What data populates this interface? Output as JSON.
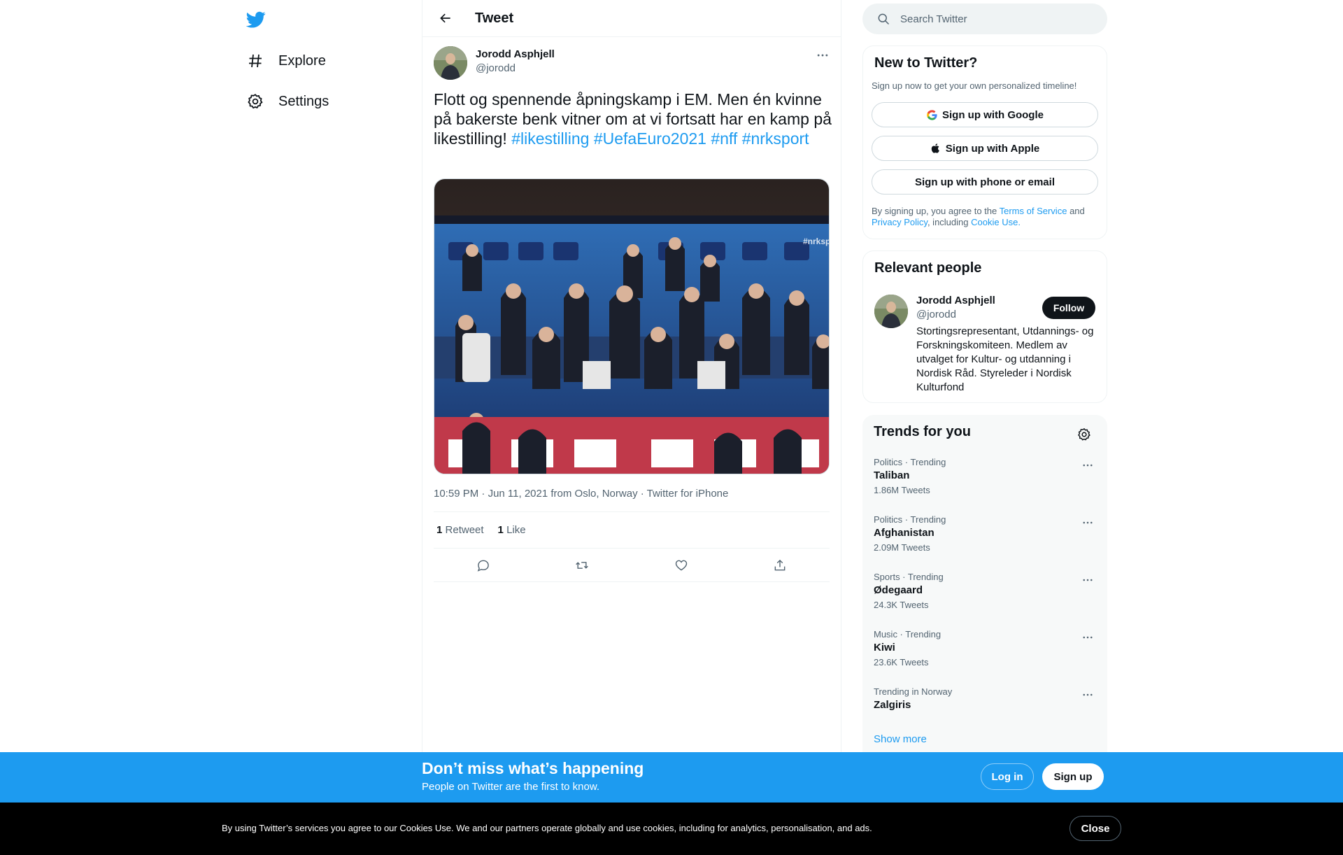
{
  "colors": {
    "accent": "#1d9bf0",
    "text": "#0f1419",
    "muted": "#536471",
    "banner": "#1d9bf0",
    "cookie_bg": "#000000"
  },
  "nav": {
    "logo_icon": "twitter-bird-icon",
    "items": [
      {
        "label": "Explore",
        "icon": "hashtag-icon"
      },
      {
        "label": "Settings",
        "icon": "gear-icon"
      }
    ]
  },
  "header": {
    "title": "Tweet",
    "back_icon": "arrow-left-icon"
  },
  "tweet": {
    "author_name": "Jorodd Asphjell",
    "author_handle": "@jorodd",
    "text": "Flott og spennende åpningskamp i EM. Men én kvinne på bakerste benk vitner om at vi fortsatt har en kamp på likestilling!",
    "hashtags": [
      "#likestilling",
      "#UefaEuro2021",
      "#nff",
      "#nrksport"
    ],
    "media_watermark": "#nrksp",
    "time": "10:59 PM",
    "date": "Jun 11, 2021",
    "location": "from Oslo, Norway",
    "source": "Twitter for iPhone",
    "retweet_count": "1",
    "retweet_label": "Retweet",
    "like_count": "1",
    "like_label": "Like",
    "action_icons": [
      "reply-icon",
      "retweet-icon",
      "like-icon",
      "share-icon"
    ]
  },
  "search": {
    "placeholder": "Search Twitter"
  },
  "new_to_twitter": {
    "title": "New to Twitter?",
    "subtitle": "Sign up now to get your own personalized timeline!",
    "google": "Sign up with Google",
    "apple": "Sign up with Apple",
    "phone": "Sign up with phone or email",
    "legal_pre": "By signing up, you agree to the",
    "terms": "Terms of Service",
    "and": "and",
    "privacy": "Privacy Policy",
    "including": ", including",
    "cookie": "Cookie Use."
  },
  "relevant": {
    "title": "Relevant people",
    "name": "Jorodd Asphjell",
    "handle": "@jorodd",
    "follow": "Follow",
    "bio": "Stortingsrepresentant, Utdannings- og Forskningskomiteen. Medlem av utvalget for Kultur- og utdanning i Nordisk Råd. Styreleder i Nordisk Kulturfond"
  },
  "trends": {
    "title": "Trends for you",
    "items": [
      {
        "category": "Politics · Trending",
        "name": "Taliban",
        "count": "1.86M Tweets"
      },
      {
        "category": "Politics · Trending",
        "name": "Afghanistan",
        "count": "2.09M Tweets"
      },
      {
        "category": "Sports · Trending",
        "name": "Ødegaard",
        "count": "24.3K Tweets"
      },
      {
        "category": "Music · Trending",
        "name": "Kiwi",
        "count": "23.6K Tweets"
      },
      {
        "category": "Trending in Norway",
        "name": "Zalgiris",
        "count": ""
      }
    ],
    "show_more": "Show more"
  },
  "banner": {
    "title": "Don’t miss what’s happening",
    "subtitle": "People on Twitter are the first to know.",
    "login": "Log in",
    "signup": "Sign up"
  },
  "cookie_bar": {
    "text": "By using Twitter’s services you agree to our Cookies Use. We and our partners operate globally and use cookies, including for analytics, personalisation, and ads.",
    "close": "Close"
  }
}
